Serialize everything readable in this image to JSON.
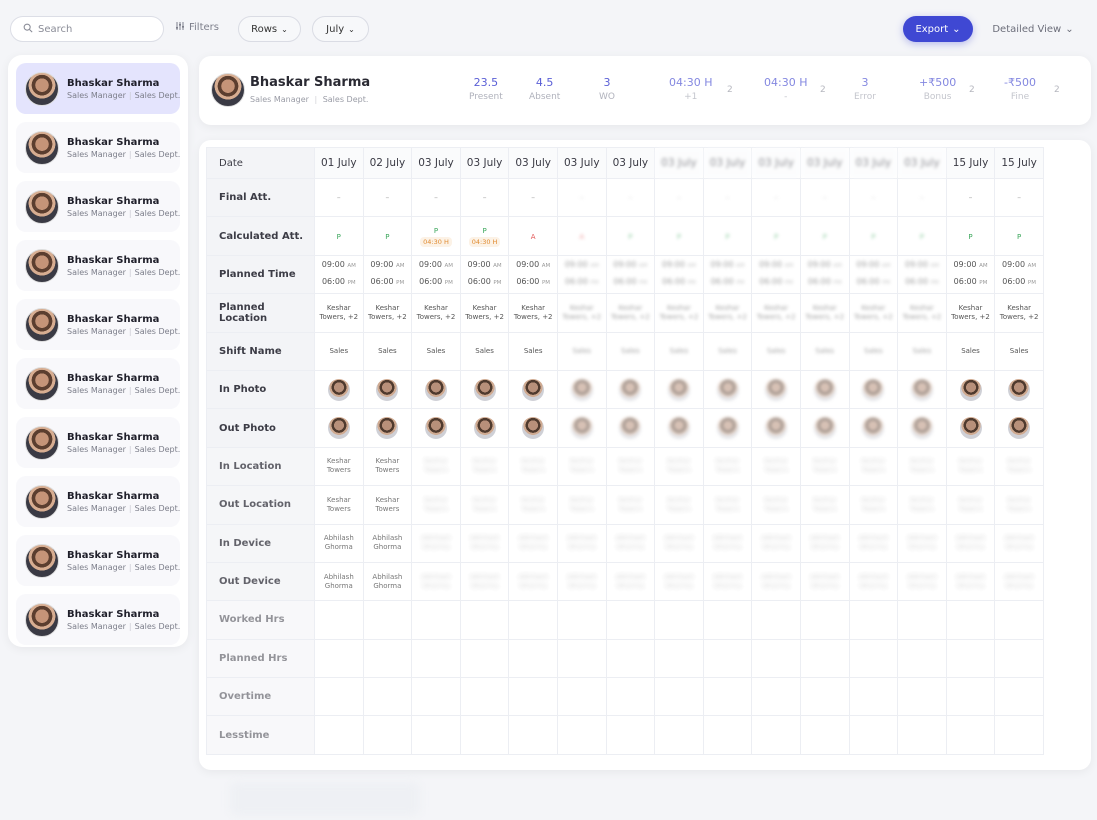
{
  "toolbar": {
    "search_placeholder": "Search",
    "filters_label": "Filters",
    "rows_label": "Rows",
    "month_label": "July",
    "export_label": "Export",
    "view_label": "Detailed View"
  },
  "icons": {
    "search": "search-icon",
    "filters": "sliders-icon",
    "chevron": "chevron-down-icon"
  },
  "colors": {
    "accent": "#3f48d3",
    "present": "#3aa65a",
    "absent": "#e25757",
    "stat": "#5a5fd6"
  },
  "employees": [
    {
      "name": "Bhaskar Sharma",
      "role": "Sales Manager",
      "dept": "Sales Dept."
    },
    {
      "name": "Bhaskar Sharma",
      "role": "Sales Manager",
      "dept": "Sales Dept."
    },
    {
      "name": "Bhaskar Sharma",
      "role": "Sales Manager",
      "dept": "Sales Dept."
    },
    {
      "name": "Bhaskar Sharma",
      "role": "Sales Manager",
      "dept": "Sales Dept."
    },
    {
      "name": "Bhaskar Sharma",
      "role": "Sales Manager",
      "dept": "Sales Dept."
    },
    {
      "name": "Bhaskar Sharma",
      "role": "Sales Manager",
      "dept": "Sales Dept."
    },
    {
      "name": "Bhaskar Sharma",
      "role": "Sales Manager",
      "dept": "Sales Dept."
    },
    {
      "name": "Bhaskar Sharma",
      "role": "Sales Manager",
      "dept": "Sales Dept."
    },
    {
      "name": "Bhaskar Sharma",
      "role": "Sales Manager",
      "dept": "Sales Dept."
    },
    {
      "name": "Bhaskar Sharma",
      "role": "Sales Manager",
      "dept": "Sales Dept."
    }
  ],
  "header": {
    "name": "Bhaskar Sharma",
    "role": "Sales Manager",
    "dept": "Sales Dept.",
    "stats": [
      {
        "value": "23.5",
        "label": "Present",
        "count": ""
      },
      {
        "value": "4.5",
        "label": "Absent",
        "count": ""
      },
      {
        "value": "3",
        "label": "WO",
        "count": ""
      },
      {
        "value": "04:30 H",
        "label": "+1",
        "count": "2"
      },
      {
        "value": "04:30 H",
        "label": "-",
        "count": "2"
      },
      {
        "value": "3",
        "label": "Error",
        "count": ""
      },
      {
        "value": "+₹500",
        "label": "Bonus",
        "count": "2"
      },
      {
        "value": "-₹500",
        "label": "Fine",
        "count": "2"
      }
    ]
  },
  "table": {
    "row_header": "Date",
    "dates": [
      "01 July",
      "02 July",
      "03 July",
      "03 July",
      "03 July",
      "03 July",
      "03 July",
      "03 July",
      "03 July",
      "03 July",
      "03 July",
      "03 July",
      "03 July",
      "15 July",
      "15 July"
    ],
    "rows": [
      "Final Att.",
      "Calculated Att.",
      "Planned Time",
      "Planned Location",
      "Shift Name",
      "In Photo",
      "Out Photo",
      "In Location",
      "Out Location",
      "In Device",
      "Out Device",
      "Worked Hrs",
      "Planned Hrs",
      "Overtime",
      "Lesstime"
    ],
    "planned_in": "09:00",
    "planned_out": "06:00",
    "am": "AM",
    "pm": "PM",
    "location_main": "Keshar",
    "location_sub": "Towers, +2",
    "location_short": "Towers",
    "shift": "Sales",
    "device_main": "Abhilash",
    "device_sub": "Ghorma",
    "present_short": "P",
    "absent_short": "A",
    "late_tag": "04:30 H"
  }
}
